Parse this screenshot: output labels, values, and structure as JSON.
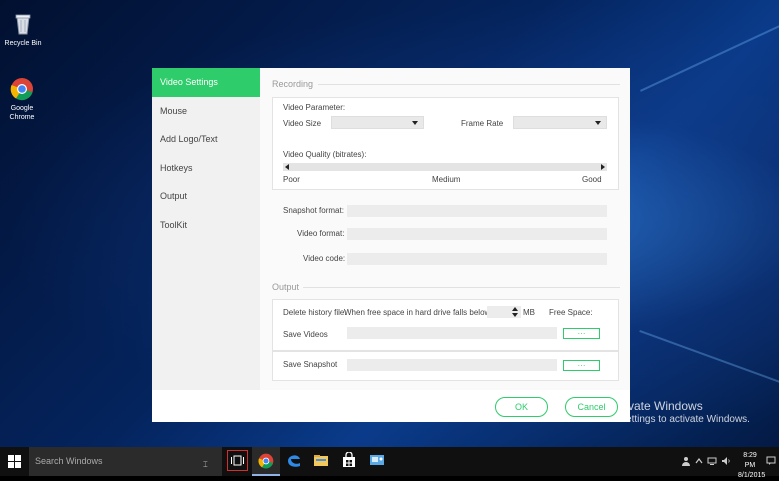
{
  "desktop": {
    "icons": [
      {
        "label": "Recycle Bin"
      },
      {
        "label": "Google Chrome"
      }
    ],
    "watermark": {
      "line1": "vate Windows",
      "line2": "o Settings to activate Windows."
    }
  },
  "dialog": {
    "sidebar": {
      "items": [
        {
          "label": "Video Settings",
          "active": true
        },
        {
          "label": "Mouse"
        },
        {
          "label": "Add Logo/Text"
        },
        {
          "label": "Hotkeys"
        },
        {
          "label": "Output"
        },
        {
          "label": "ToolKit"
        }
      ]
    },
    "recording": {
      "title": "Recording",
      "video_parameter": "Video Parameter:",
      "video_size_label": "Video Size",
      "video_size_value": "",
      "frame_rate_label": "Frame Rate",
      "frame_rate_value": "",
      "quality_label": "Video Quality (bitrates):",
      "quality_ticks": [
        "Poor",
        "Medium",
        "Good"
      ],
      "snapshot_format_label": "Snapshot format:",
      "snapshot_format_value": "",
      "video_format_label": "Video format:",
      "video_format_value": "",
      "video_code_label": "Video code:",
      "video_code_value": ""
    },
    "output": {
      "title": "Output",
      "delete_history_label": "Delete history file:",
      "free_space_condition": "When free space in hard drive falls below :",
      "threshold_value": "",
      "unit": "MB",
      "free_space_label": "Free Space:",
      "free_space_value": "",
      "save_videos_label": "Save Videos",
      "save_videos_path": "",
      "save_snapshot_label": "Save Snapshot",
      "save_snapshot_path": "",
      "browse_label": "···"
    },
    "ok_label": "OK",
    "cancel_label": "Cancel"
  },
  "taskbar": {
    "search_placeholder": "Search Windows",
    "clock_time": "8:29 PM",
    "clock_date": "8/1/2015"
  },
  "colors": {
    "accent": "#2ecc6a",
    "taskbar": "#101010"
  }
}
